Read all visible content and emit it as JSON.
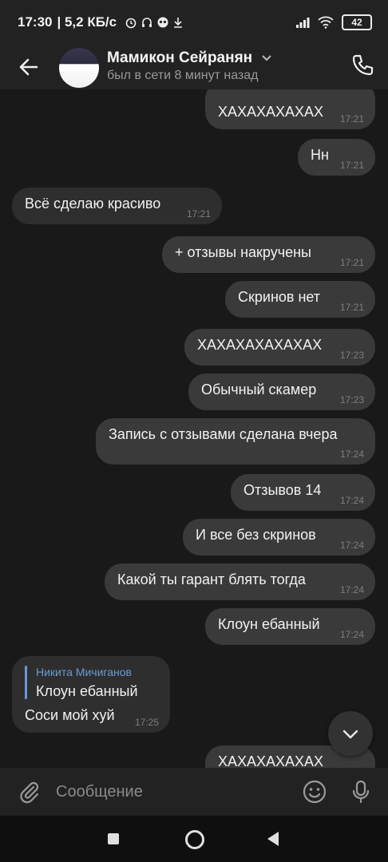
{
  "status_bar": {
    "time": "17:30",
    "speed": "| 5,2 КБ/с",
    "battery": "42"
  },
  "header": {
    "contact_name": "Мамикон Сейранян",
    "last_seen": "был в сети 8 минут назад"
  },
  "messages": [
    {
      "direction": "out",
      "text": "ХАХАХАХАХАХ",
      "time": "17:21"
    },
    {
      "direction": "out",
      "text": "Нн",
      "time": "17:21"
    },
    {
      "direction": "in",
      "text": "Всё сделаю красиво",
      "time": "17:21"
    },
    {
      "direction": "out",
      "text": "+ отзывы накручены",
      "time": "17:21"
    },
    {
      "direction": "out",
      "text": "Скринов нет",
      "time": "17:21"
    },
    {
      "direction": "out",
      "text": "ХАХАХАХАХАХАХ",
      "time": "17:23"
    },
    {
      "direction": "out",
      "text": "Обычный скамер",
      "time": "17:23"
    },
    {
      "direction": "out",
      "text": "Запись с отзывами сделана вчера",
      "time": "17:24"
    },
    {
      "direction": "out",
      "text": "Отзывов 14",
      "time": "17:24"
    },
    {
      "direction": "out",
      "text": "И все без скринов",
      "time": "17:24"
    },
    {
      "direction": "out",
      "text": "Какой ты гарант блять тогда",
      "time": "17:24"
    },
    {
      "direction": "out",
      "text": "Клоун ебанный",
      "time": "17:24"
    },
    {
      "direction": "in",
      "reply_author": "Никита Мичиганов",
      "reply_text": "Клоун ебанный",
      "text": "Соси мой хуй",
      "time": "17:25"
    },
    {
      "direction": "out",
      "text": "ХАХАХАХАХАХ",
      "time": ""
    }
  ],
  "composer": {
    "placeholder": "Сообщение"
  },
  "icons": [
    "back-arrow-icon",
    "chevron-down-icon",
    "phone-icon",
    "chevron-down-icon",
    "paperclip-icon",
    "emoji-icon",
    "microphone-icon"
  ],
  "colors": {
    "background": "#191919",
    "bubble_out": "#3a3a3b",
    "bubble_in": "#2e2e2f",
    "reply_accent": "#6a9bd4"
  }
}
